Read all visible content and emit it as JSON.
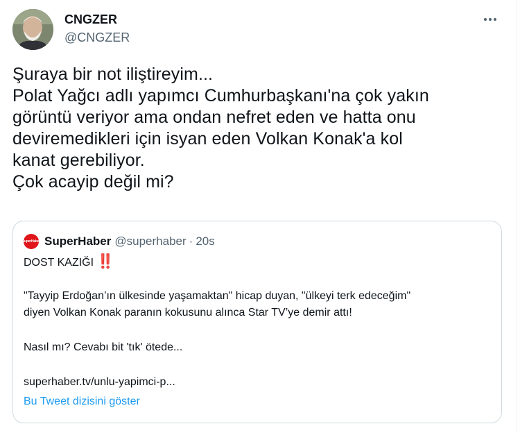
{
  "author": {
    "display_name": "CNGZER",
    "handle": "@CNGZER"
  },
  "more_menu_icon": "more-horizontal-icon",
  "tweet": {
    "lines": [
      "Şuraya bir not iliştireyim...",
      "Polat Yağcı adlı yapımcı Cumhurbaşkanı'na çok yakın",
      "görüntü veriyor ama ondan nefret eden ve hatta onu",
      "deviremedikleri için isyan eden Volkan Konak'a kol",
      "kanat gerebiliyor.",
      "Çok acayip değil mi?"
    ]
  },
  "quoted": {
    "avatar_text": "SuperHaber",
    "display_name": "SuperHaber",
    "handle": "@superhaber",
    "separator": "·",
    "time": "20s",
    "headline": "DOST KAZIĞI",
    "headline_emoji": "‼️",
    "paragraph_lines": [
      "\"Tayyip Erdoğan’ın ülkesinde yaşamaktan\" hicap duyan, \"ülkeyi terk edeceğim\"",
      "diyen Volkan Konak paranın kokusunu alınca Star TV’ye demir attı!"
    ],
    "teaser": "Nasıl mı? Cevabı bit 'tık' ötede...",
    "link": "superhaber.tv/unlu-yapimci-p...",
    "show_thread": "Bu Tweet dizisini göster"
  },
  "colors": {
    "text": "#0f1419",
    "secondary": "#536471",
    "accent": "#1d9bf0",
    "border": "#cfd9de",
    "brand_red": "#e0161b"
  }
}
